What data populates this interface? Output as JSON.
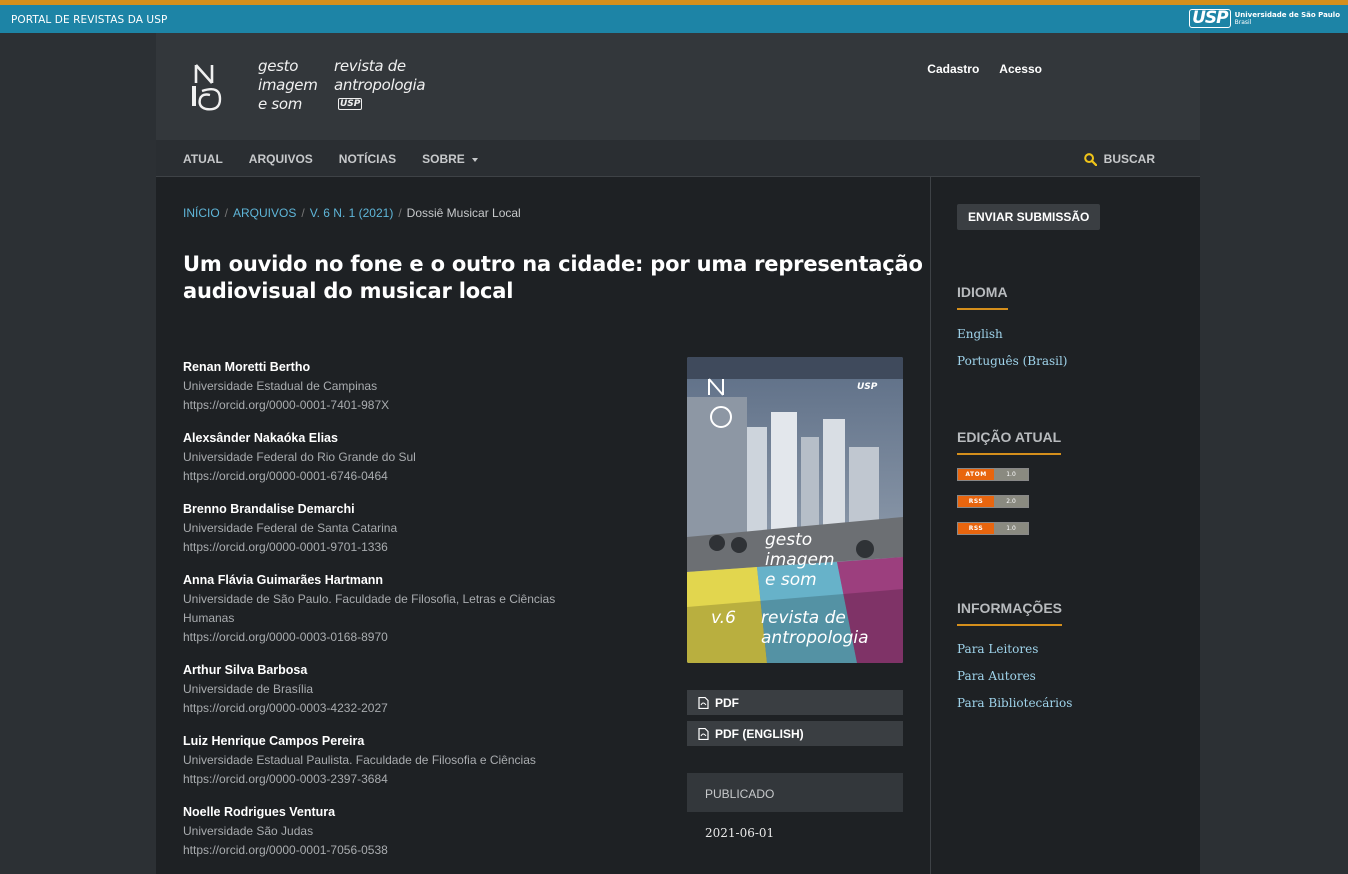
{
  "top_bar": {
    "portal_label": "PORTAL DE REVISTAS DA USP",
    "usp_mark": "USP",
    "usp_name": "Universidade de São Paulo",
    "usp_country": "Brasil"
  },
  "header": {
    "logo_left": [
      "gesto",
      "imagem",
      "e som"
    ],
    "logo_right": [
      "revista de",
      "antropologia"
    ],
    "logo_usp": "USP",
    "user_links": [
      "Cadastro",
      "Acesso"
    ]
  },
  "nav": {
    "items": [
      "ATUAL",
      "ARQUIVOS",
      "NOTÍCIAS",
      "SOBRE"
    ],
    "search_label": "BUSCAR"
  },
  "breadcrumb": {
    "home": "INÍCIO",
    "archives": "ARQUIVOS",
    "issue": "V. 6 N. 1 (2021)",
    "current": "Dossiê Musicar Local"
  },
  "article": {
    "title": "Um ouvido no fone e o outro na cidade: por uma representação audiovisual do musicar local",
    "authors": [
      {
        "name": "Renan Moretti Bertho",
        "affiliation": "Universidade Estadual de Campinas",
        "orcid": "https://orcid.org/0000-0001-7401-987X"
      },
      {
        "name": "Alexsânder Nakaóka Elias",
        "affiliation": "Universidade Federal do Rio Grande do Sul",
        "orcid": "https://orcid.org/0000-0001-6746-0464"
      },
      {
        "name": "Brenno Brandalise Demarchi",
        "affiliation": "Universidade Federal de Santa Catarina",
        "orcid": "https://orcid.org/0000-0001-9701-1336"
      },
      {
        "name": "Anna Flávia Guimarães Hartmann",
        "affiliation": "Universidade de São Paulo. Faculdade de Filosofia, Letras e Ciências Humanas",
        "orcid": "https://orcid.org/0000-0003-0168-8970"
      },
      {
        "name": "Arthur Silva Barbosa",
        "affiliation": "Universidade de Brasília",
        "orcid": "https://orcid.org/0000-0003-4232-2027"
      },
      {
        "name": "Luiz Henrique Campos Pereira",
        "affiliation": "Universidade Estadual Paulista. Faculdade de Filosofia e Ciências",
        "orcid": "https://orcid.org/0000-0003-2397-3684"
      },
      {
        "name": "Noelle Rodrigues Ventura",
        "affiliation": "Universidade São Judas",
        "orcid": "https://orcid.org/0000-0001-7056-0538"
      }
    ],
    "cover": {
      "title_lines": [
        "gesto",
        "imagem",
        "e som"
      ],
      "subtitle_lines": [
        "revista de",
        "antropologia"
      ],
      "volume": "v.6"
    },
    "downloads": [
      "PDF",
      "PDF (ENGLISH)"
    ],
    "published_label": "PUBLICADO",
    "published_date": "2021-06-01"
  },
  "sidebar": {
    "submit_label": "ENVIAR SUBMISSÃO",
    "language_title": "IDIOMA",
    "languages": [
      "English",
      "Português (Brasil)"
    ],
    "current_issue_title": "EDIÇÃO ATUAL",
    "feeds": [
      {
        "left": "ATOM",
        "right": "1.0"
      },
      {
        "left": "RSS",
        "right": "2.0"
      },
      {
        "left": "RSS",
        "right": "1.0"
      }
    ],
    "info_title": "INFORMAÇÕES",
    "info_links": [
      "Para Leitores",
      "Para Autores",
      "Para Bibliotecários"
    ]
  },
  "colors": {
    "accent_orange": "#d48f1c",
    "usp_blue": "#1d84a6",
    "link_blue": "#5fb6d9"
  }
}
